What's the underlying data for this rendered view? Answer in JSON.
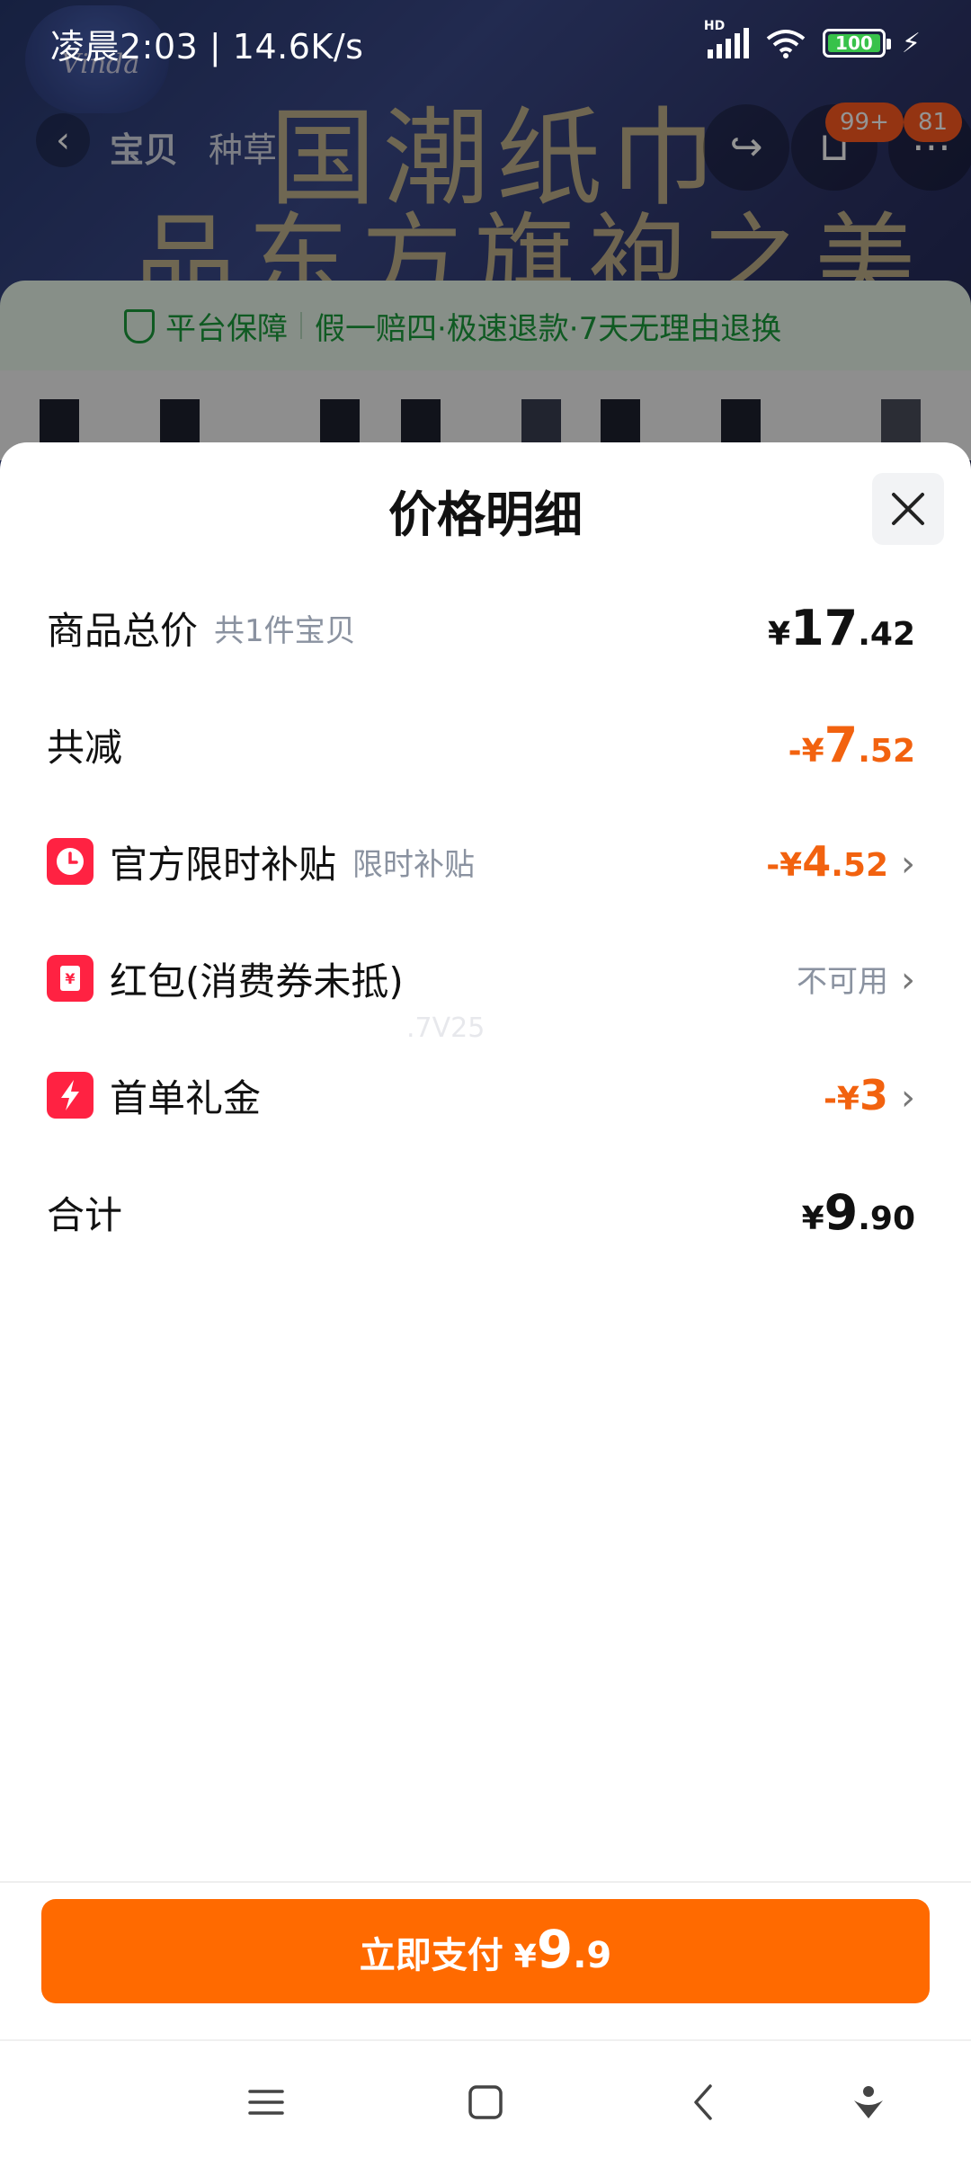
{
  "status_bar": {
    "time_speed": "凌晨2:03 | 14.6K/s",
    "hd_label": "HD",
    "battery_level": "100"
  },
  "background": {
    "logo_text": "Vinda",
    "banner_line1": "国潮纸巾",
    "banner_line2": "品东方旗袍之美",
    "nav_tabs": [
      "宝贝",
      "种草"
    ],
    "badge_1": "99+",
    "badge_2": "81",
    "guarantee_label": "平台保障",
    "guarantee_text": "假一赔四·极速退款·7天无理由退换"
  },
  "sheet": {
    "title": "价格明细",
    "watermark": ".7V25",
    "rows": {
      "total": {
        "label": "商品总价",
        "sub": "共1件宝贝",
        "currency": "¥",
        "int": "17",
        "dec": ".42"
      },
      "reduction": {
        "label": "共减",
        "prefix": "-¥",
        "int": "7",
        "dec": ".52"
      },
      "subsidy": {
        "label": "官方限时补贴",
        "sub": "限时补贴",
        "prefix": "-¥",
        "int": "4",
        "dec": ".52"
      },
      "red_packet": {
        "label": "红包(消费券未抵)",
        "value": "不可用"
      },
      "first_order": {
        "label": "首单礼金",
        "prefix": "-¥",
        "int": "3"
      },
      "sum": {
        "label": "合计",
        "currency": "¥",
        "int": "9",
        "dec": ".90"
      }
    }
  },
  "pay_button": {
    "label": "立即支付",
    "currency": "¥",
    "int": "9",
    "dec": ".9"
  },
  "colors": {
    "accent_orange": "#ff6a00",
    "discount_orange": "#f2620f",
    "icon_red": "#ff2242",
    "muted_gray": "#8a92a0"
  },
  "icons": {
    "subsidy": "clock-icon",
    "red_packet": "yuan-envelope-icon",
    "first_order": "lightning-icon",
    "close": "close-icon",
    "chevron": "chevron-right-icon"
  }
}
